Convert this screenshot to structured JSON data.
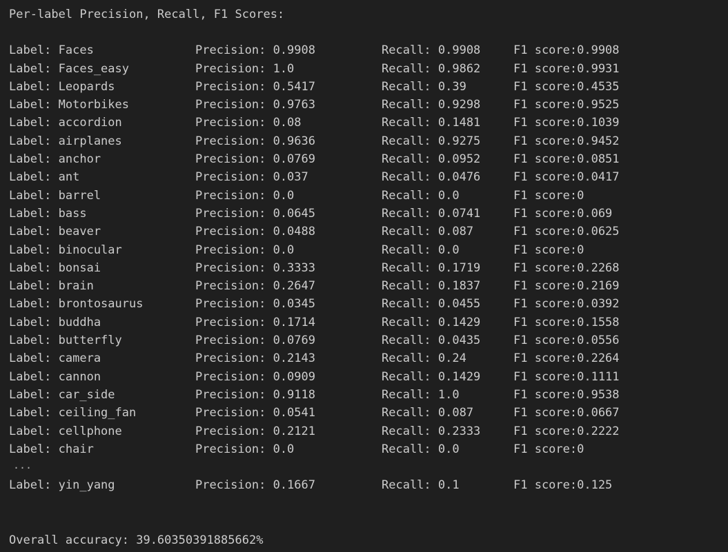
{
  "header": "Per-label Precision, Recall, F1 Scores:",
  "rows": [
    {
      "label": "Label: Faces",
      "precision": "Precision: 0.9908",
      "recall": "Recall: 0.9908",
      "f1": "F1 score:0.9908"
    },
    {
      "label": "Label: Faces_easy",
      "precision": "Precision: 1.0",
      "recall": "Recall: 0.9862",
      "f1": "F1 score:0.9931"
    },
    {
      "label": "Label: Leopards",
      "precision": "Precision: 0.5417",
      "recall": "Recall: 0.39",
      "f1": "F1 score:0.4535"
    },
    {
      "label": "Label: Motorbikes",
      "precision": "Precision: 0.9763",
      "recall": "Recall: 0.9298",
      "f1": "F1 score:0.9525"
    },
    {
      "label": "Label: accordion",
      "precision": "Precision: 0.08",
      "recall": "Recall: 0.1481",
      "f1": "F1 score:0.1039"
    },
    {
      "label": "Label: airplanes",
      "precision": "Precision: 0.9636",
      "recall": "Recall: 0.9275",
      "f1": "F1 score:0.9452"
    },
    {
      "label": "Label: anchor",
      "precision": "Precision: 0.0769",
      "recall": "Recall: 0.0952",
      "f1": "F1 score:0.0851"
    },
    {
      "label": "Label: ant",
      "precision": "Precision: 0.037",
      "recall": "Recall: 0.0476",
      "f1": "F1 score:0.0417"
    },
    {
      "label": "Label: barrel",
      "precision": "Precision: 0.0",
      "recall": "Recall: 0.0",
      "f1": "F1 score:0"
    },
    {
      "label": "Label: bass",
      "precision": "Precision: 0.0645",
      "recall": "Recall: 0.0741",
      "f1": "F1 score:0.069"
    },
    {
      "label": "Label: beaver",
      "precision": "Precision: 0.0488",
      "recall": "Recall: 0.087",
      "f1": "F1 score:0.0625"
    },
    {
      "label": "Label: binocular",
      "precision": "Precision: 0.0",
      "recall": "Recall: 0.0",
      "f1": "F1 score:0"
    },
    {
      "label": "Label: bonsai",
      "precision": "Precision: 0.3333",
      "recall": "Recall: 0.1719",
      "f1": "F1 score:0.2268"
    },
    {
      "label": "Label: brain",
      "precision": "Precision: 0.2647",
      "recall": "Recall: 0.1837",
      "f1": "F1 score:0.2169"
    },
    {
      "label": "Label: brontosaurus",
      "precision": "Precision: 0.0345",
      "recall": "Recall: 0.0455",
      "f1": "F1 score:0.0392"
    },
    {
      "label": "Label: buddha",
      "precision": "Precision: 0.1714",
      "recall": "Recall: 0.1429",
      "f1": "F1 score:0.1558"
    },
    {
      "label": "Label: butterfly",
      "precision": "Precision: 0.0769",
      "recall": "Recall: 0.0435",
      "f1": "F1 score:0.0556"
    },
    {
      "label": "Label: camera",
      "precision": "Precision: 0.2143",
      "recall": "Recall: 0.24",
      "f1": "F1 score:0.2264"
    },
    {
      "label": "Label: cannon",
      "precision": "Precision: 0.0909",
      "recall": "Recall: 0.1429",
      "f1": "F1 score:0.1111"
    },
    {
      "label": "Label: car_side",
      "precision": "Precision: 0.9118",
      "recall": "Recall: 1.0",
      "f1": "F1 score:0.9538"
    },
    {
      "label": "Label: ceiling_fan",
      "precision": "Precision: 0.0541",
      "recall": "Recall: 0.087",
      "f1": "F1 score:0.0667"
    },
    {
      "label": "Label: cellphone",
      "precision": "Precision: 0.2121",
      "recall": "Recall: 0.2333",
      "f1": "F1 score:0.2222"
    },
    {
      "label": "Label: chair",
      "precision": "Precision: 0.0",
      "recall": "Recall: 0.0",
      "f1": "F1 score:0"
    }
  ],
  "ellipsis": "...",
  "last_row": {
    "label": "Label: yin_yang",
    "precision": "Precision: 0.1667",
    "recall": "Recall: 0.1",
    "f1": "F1 score:0.125"
  },
  "overall": "Overall accuracy: 39.60350391885662%"
}
